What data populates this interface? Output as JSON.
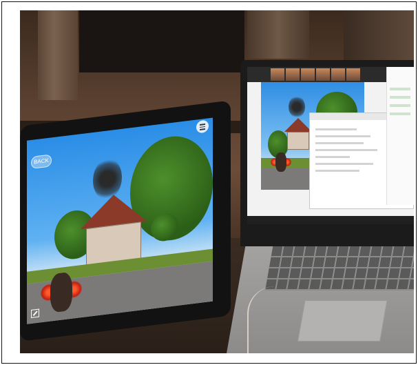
{
  "image": {
    "tablet_app": {
      "back_label": "BACK",
      "menu_icon": "menu-icon",
      "expand_icon": "expand-icon"
    },
    "colors": {
      "robot_glow": "#c21e10",
      "sky": "#2a8de6",
      "house_roof": "#8b3a2a"
    }
  }
}
